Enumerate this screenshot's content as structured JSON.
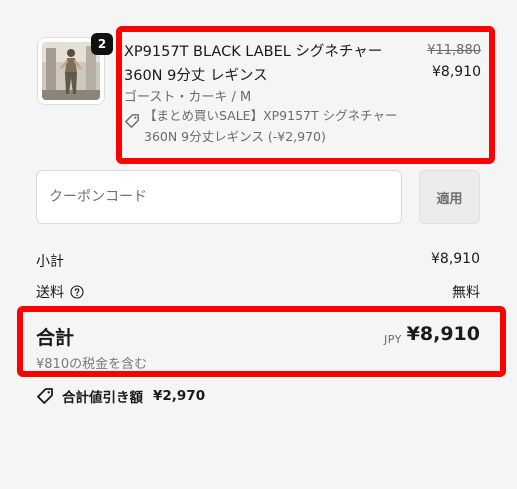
{
  "cart_item": {
    "quantity": "2",
    "title": "XP9157T BLACK LABEL シグネチャー360N 9分丈 レギンス",
    "price_original": "¥11,880",
    "price_current": "¥8,910",
    "variant": "ゴースト・カーキ / M",
    "discount_label": "【まとめ買いSALE】XP9157T シグネチャー360N 9分丈レギンス (-¥2,970)",
    "image_icon": "product-photo-woman-in-leggings"
  },
  "coupon": {
    "placeholder": "クーポンコード",
    "apply_label": "適用"
  },
  "summary": {
    "subtotal_label": "小計",
    "subtotal_value": "¥8,910",
    "shipping_label": "送料",
    "shipping_value": "無料",
    "total_label": "合計",
    "total_currency": "JPY",
    "total_value": "¥8,910",
    "tax_note": "¥810の税金を含む",
    "savings_label": "合計値引き額",
    "savings_value": "¥2,970"
  },
  "colors": {
    "highlight_border": "#ff0000",
    "background": "#f5f5f5",
    "badge": "#111111"
  }
}
